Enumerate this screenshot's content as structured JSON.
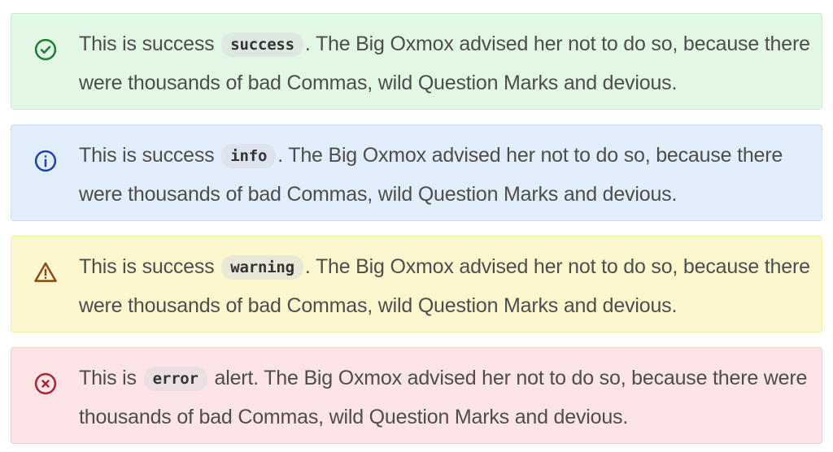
{
  "colors": {
    "success_icon": "#1e7b38",
    "info_icon": "#1f43a5",
    "warning_icon": "#8a4b10",
    "error_icon": "#a8242f",
    "text": "#4d4d4d"
  },
  "alerts": [
    {
      "type": "success",
      "icon": "check-circle-icon",
      "prefix": "This is success",
      "code": "success",
      "suffix": ". The Big Oxmox advised her not to do so, because there were thousands of bad Commas, wild Question Marks and devious."
    },
    {
      "type": "info",
      "icon": "info-circle-icon",
      "prefix": "This is success",
      "code": "info",
      "suffix": ". The Big Oxmox advised her not to do so, because there were thousands of bad Commas, wild Question Marks and devious."
    },
    {
      "type": "warning",
      "icon": "warning-triangle-icon",
      "prefix": "This is success",
      "code": "warning",
      "suffix": ". The Big Oxmox advised her not to do so, because there were thousands of bad Commas, wild Question Marks and devious."
    },
    {
      "type": "error",
      "icon": "x-circle-icon",
      "prefix": "This is",
      "code": "error",
      "suffix": "alert. The Big Oxmox advised her not to do so, because there were thousands of bad Commas, wild Question Marks and devious."
    }
  ]
}
